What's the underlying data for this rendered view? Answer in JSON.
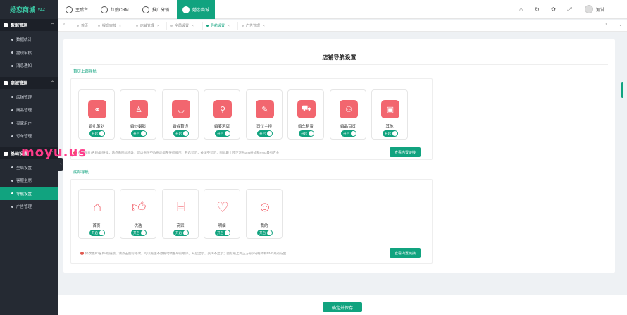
{
  "brand": {
    "name": "婚恋商城",
    "version": "v3.2"
  },
  "sidebar": {
    "sections": [
      {
        "title": "数据管理",
        "items": [
          "数据统计",
          "提现审核",
          "消息通知"
        ]
      },
      {
        "title": "商城管理",
        "items": [
          "店铺管理",
          "商品管理",
          "买家用户",
          "订单管理"
        ]
      },
      {
        "title": "基础设置",
        "items": [
          "全局设置",
          "客服坐席",
          "导航设置",
          "广告管理"
        ]
      }
    ],
    "active_item": "导航设置"
  },
  "topbar": {
    "apps": [
      {
        "label": "主后台",
        "icon": "home-icon"
      },
      {
        "label": "红娘CRM",
        "icon": "heart-icon"
      },
      {
        "label": "推广分销",
        "icon": "share-icon"
      },
      {
        "label": "婚恋商城",
        "icon": "shop-icon",
        "active": true
      }
    ],
    "user": "测试",
    "icons": [
      "home-icon",
      "refresh-icon",
      "palette-icon",
      "fullscreen-icon"
    ]
  },
  "page_tabs": [
    {
      "label": "首页"
    },
    {
      "label": "提现审核"
    },
    {
      "label": "店铺管理"
    },
    {
      "label": "全局设置"
    },
    {
      "label": "导航设置",
      "active": true
    },
    {
      "label": "广告管理"
    }
  ],
  "main": {
    "title": "店铺导航设置",
    "top_nav": {
      "label": "首页上部导航",
      "cards": [
        {
          "label": "婚礼策划",
          "icon": "people-icon",
          "toggle": "开启"
        },
        {
          "label": "婚纱摄影",
          "icon": "dress-icon",
          "toggle": "开启"
        },
        {
          "label": "婚戒首饰",
          "icon": "necklace-icon",
          "toggle": "开启"
        },
        {
          "label": "婚宴酒店",
          "icon": "location-icon",
          "toggle": "开启"
        },
        {
          "label": "司仪主持",
          "icon": "microphone-icon",
          "toggle": "开启"
        },
        {
          "label": "婚车租赁",
          "icon": "car-icon",
          "toggle": "开启"
        },
        {
          "label": "婚品百货",
          "icon": "couple-icon",
          "toggle": "开启"
        },
        {
          "label": "其他",
          "icon": "box-icon",
          "toggle": "开启"
        }
      ],
      "hint": "修改图片/名称/跳链接，请点击图标修改，可以拖住不放拖动调整导航顺序。开启显示，关闭不显示；图标最上传正方形png格式和PNG最有方金",
      "button": "查看内置链接"
    },
    "bottom_nav": {
      "label": "底部导航",
      "cards": [
        {
          "label": "首页",
          "icon": "house-icon",
          "toggle": "开启"
        },
        {
          "label": "优选",
          "icon": "thumbs-up-icon",
          "toggle": "开启"
        },
        {
          "label": "商家",
          "icon": "store-icon",
          "toggle": "开启"
        },
        {
          "label": "明细",
          "icon": "heart-outline-icon",
          "toggle": "开启"
        },
        {
          "label": "我的",
          "icon": "user-icon",
          "toggle": "开启"
        }
      ],
      "hint": "修改图片/名称/跳链接，请点击图标修改，可以拖住不放拖动调整导航顺序。开启显示，关闭不显示；图标最上传正方形png格式和PNG最有方金",
      "button": "查看内置链接"
    },
    "save_label": "确定并保存"
  },
  "watermark": "moyu.us",
  "colors": {
    "accent": "#11a37f",
    "icon_red": "#f2666f",
    "sidebar": "#252a33"
  }
}
